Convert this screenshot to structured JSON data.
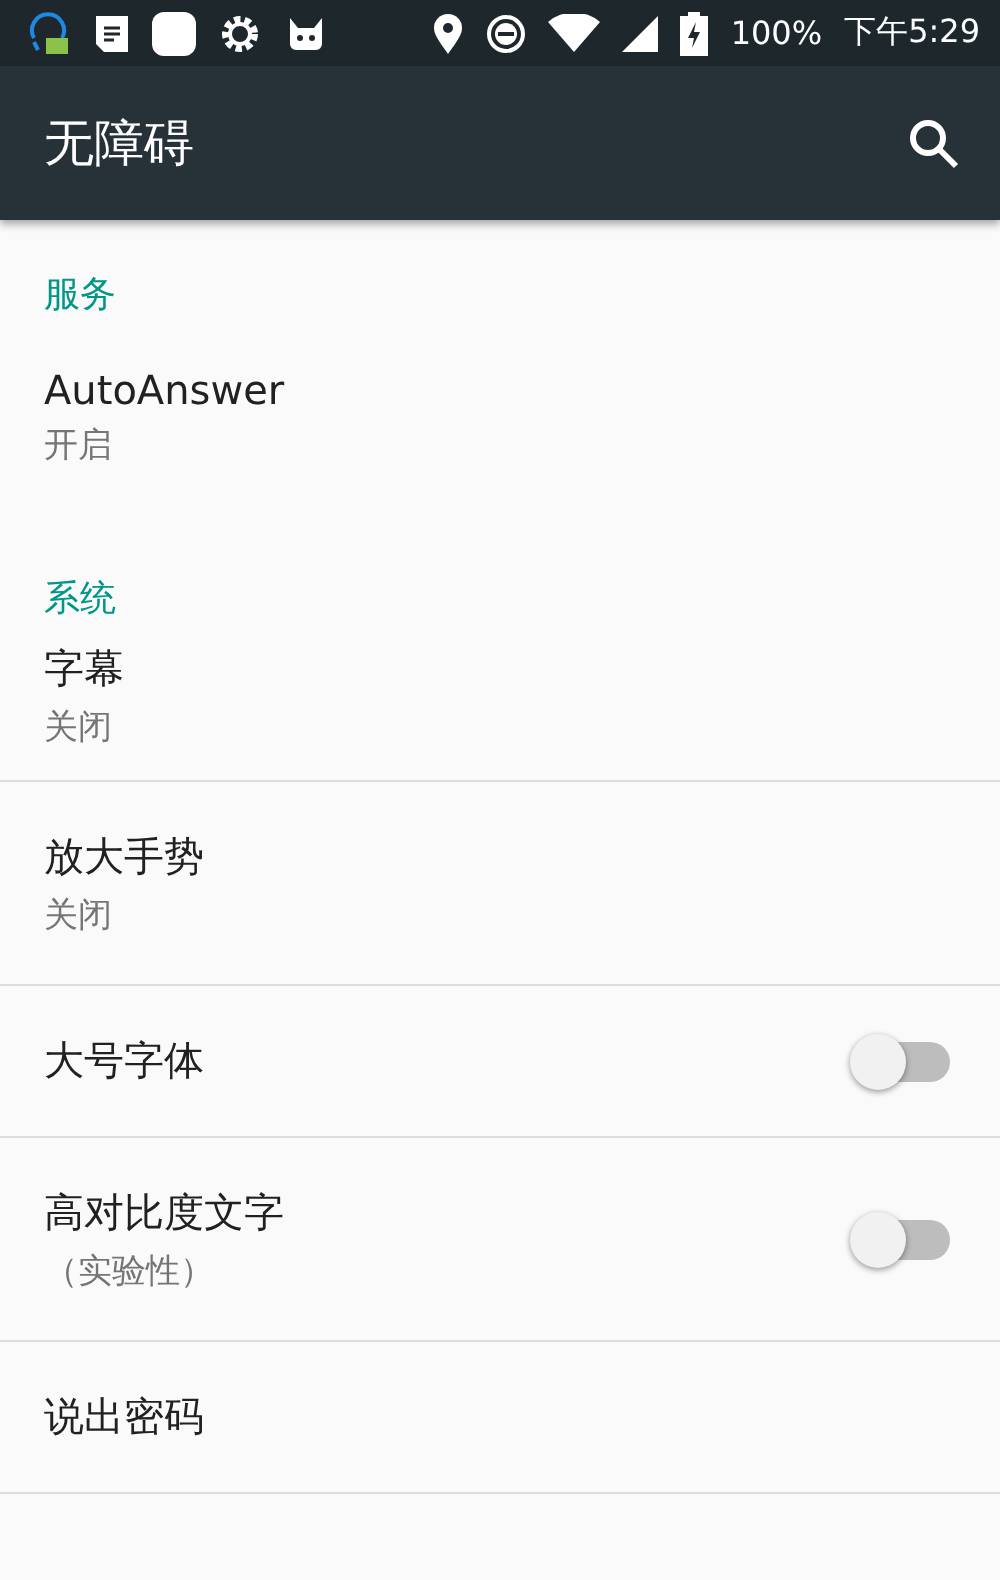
{
  "status_bar": {
    "battery": "100%",
    "time": "下午5:29"
  },
  "toolbar": {
    "title": "无障碍"
  },
  "list": [
    {
      "kind": "header",
      "title": "服务"
    },
    {
      "kind": "item",
      "title": "AutoAnswer",
      "summary": "开启",
      "divider": false
    },
    {
      "kind": "header",
      "title": "系统"
    },
    {
      "kind": "item",
      "title": "字幕",
      "summary": "关闭",
      "divider": true
    },
    {
      "kind": "item",
      "title": "放大手势",
      "summary": "关闭",
      "divider": true
    },
    {
      "kind": "switch",
      "title": "大号字体",
      "on": false,
      "divider": true
    },
    {
      "kind": "switch",
      "title": "高对比度文字",
      "summary": "（实验性）",
      "on": false,
      "divider": true
    },
    {
      "kind": "item",
      "title": "说出密码",
      "divider": true
    }
  ]
}
